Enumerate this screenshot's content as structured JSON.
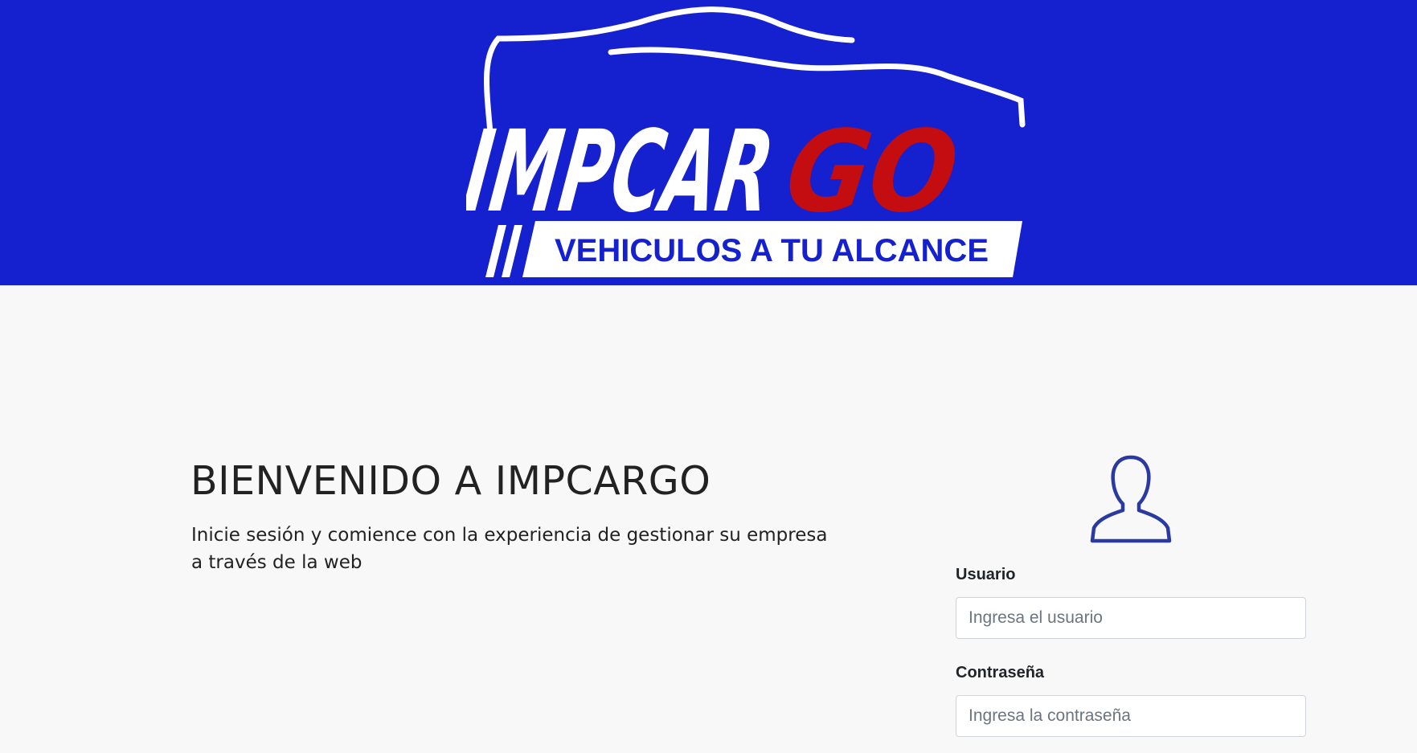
{
  "header": {
    "brand": {
      "logo_word_white": "IMPCAR",
      "logo_word_red": "GO",
      "tagline": "VEHICULOS A TU ALCANCE",
      "colors": {
        "background": "#1520cf",
        "accent": "#c30d10",
        "text": "#ffffff"
      }
    }
  },
  "main": {
    "title": "BIENVENIDO A IMPCARGO",
    "subtitle": "Inicie sesión y comience con la experiencia de gestionar su empresa a través de la web"
  },
  "login": {
    "icon": "user-silhouette-icon",
    "username": {
      "label": "Usuario",
      "placeholder": "Ingresa el usuario",
      "value": ""
    },
    "password": {
      "label": "Contraseña",
      "placeholder": "Ingresa la contraseña",
      "value": ""
    }
  }
}
